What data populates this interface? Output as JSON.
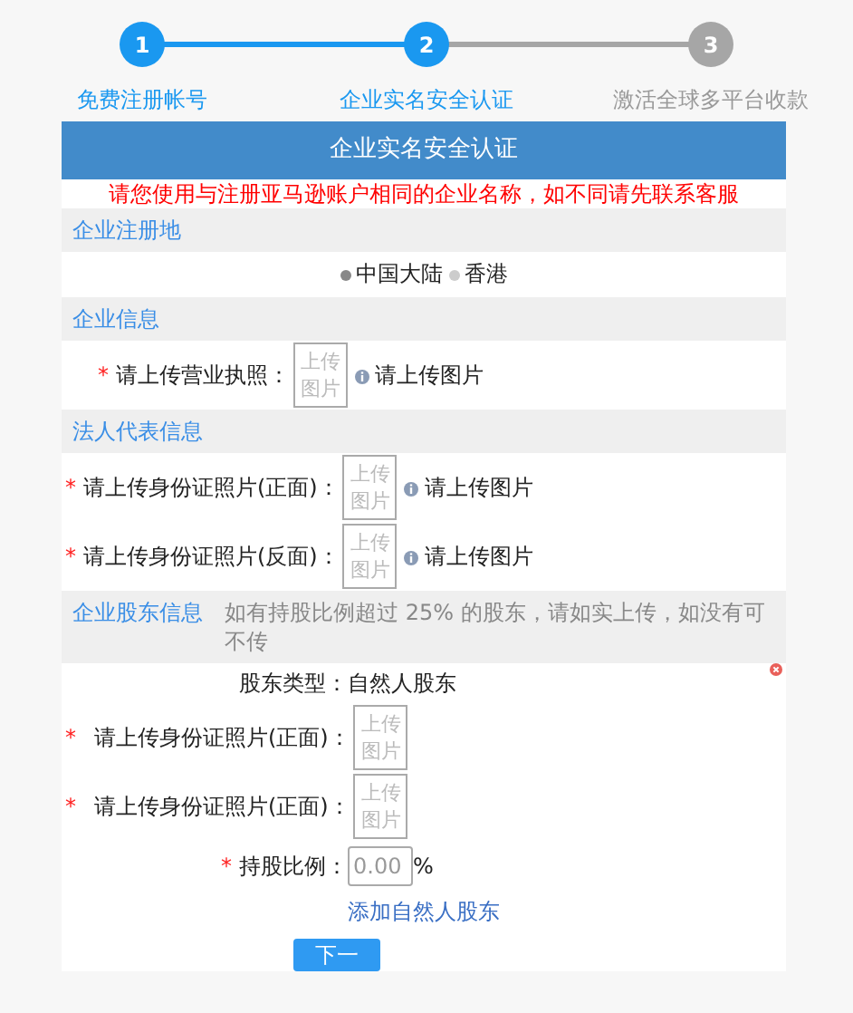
{
  "steps": [
    {
      "number": "1",
      "label": "免费注册帐号",
      "done": true
    },
    {
      "number": "2",
      "label": "企业实名安全认证",
      "done": true
    },
    {
      "number": "3",
      "label": "激活全球多平台收款",
      "done": false
    }
  ],
  "card": {
    "title": "企业实名安全认证",
    "notice": "请您使用与注册亚马逊账户相同的企业名称，如不同请先联系客服"
  },
  "sections": [
    {
      "kind": "radios",
      "title": "企业注册地",
      "options": [
        {
          "label": "中国大陆",
          "selected": true
        },
        {
          "label": "香港",
          "selected": false
        }
      ]
    },
    {
      "kind": "uploads",
      "title": "企业信息",
      "fields": [
        {
          "mark": "*",
          "label": "请上传营业执照：",
          "button": "上传图片",
          "hint": "请上传图片"
        }
      ]
    },
    {
      "kind": "uploads",
      "title": "法人代表信息",
      "fields": [
        {
          "mark": "*",
          "label": "请上传身份证照片(正面)：",
          "button": "上传图片",
          "hint": "请上传图片"
        },
        {
          "mark": "*",
          "label": "请上传身份证照片(反面)：",
          "button": "上传图片",
          "hint": "请上传图片"
        }
      ]
    },
    {
      "kind": "shareholder",
      "title": "企业股东信息",
      "note": "如有持股比例超过 25% 的股东，请如实上传，如没有可不传",
      "type_label": "股东类型：",
      "type_value": "自然人股东",
      "fields": [
        {
          "mark": "*",
          "label": "请上传身份证照片(正面)：",
          "button": "上传图片"
        },
        {
          "mark": "*",
          "label": "请上传身份证照片(正面)：",
          "button": "上传图片"
        }
      ],
      "ratio": {
        "mark": "*",
        "label": "持股比例：",
        "value": "0.00",
        "unit": "%"
      },
      "add_link": "添加自然人股东"
    }
  ],
  "next_button": "下一"
}
